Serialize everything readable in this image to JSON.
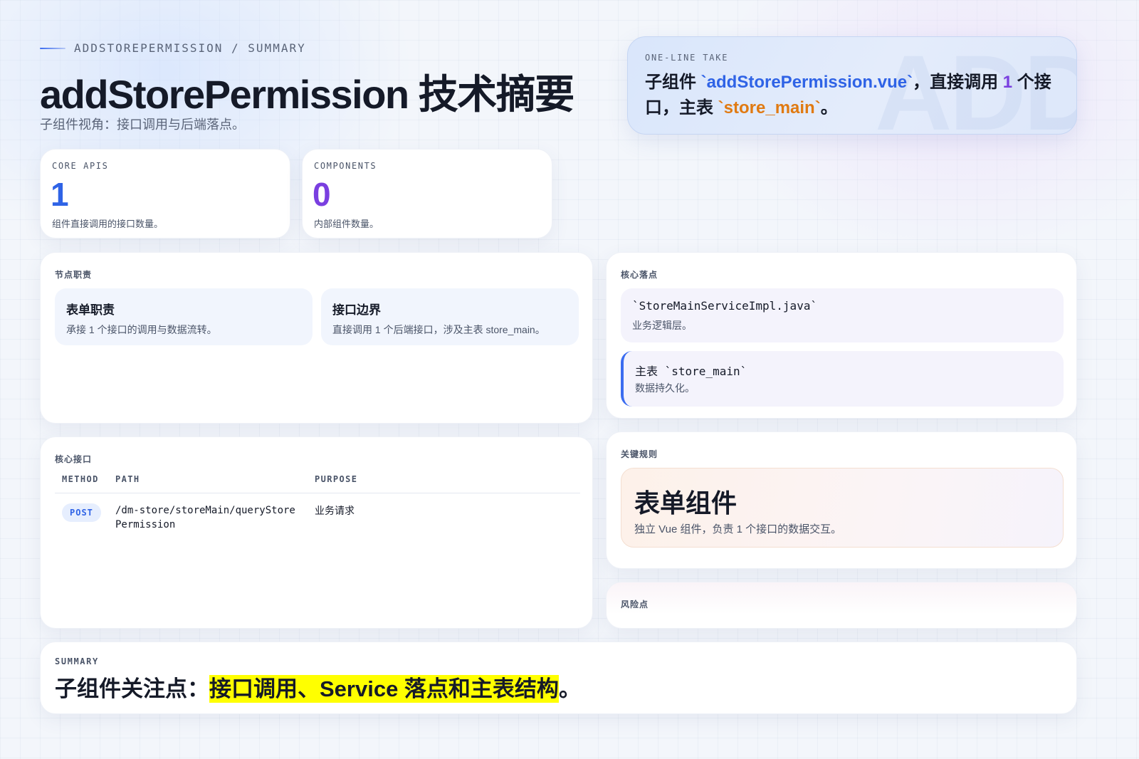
{
  "header": {
    "eyebrow": "ADDSTOREPERMISSION / SUMMARY",
    "title": "addStorePermission 技术摘要",
    "subtitle": "子组件视角：接口调用与后端落点。"
  },
  "take": {
    "label": "ONE-LINE TAKE",
    "watermark": "ADD",
    "parts": [
      "子组件 ",
      "`addStorePermission.vue`",
      "，直接调用 ",
      "1",
      " 个接口，主表 ",
      "`store_main`",
      "。"
    ]
  },
  "stats": [
    {
      "label": "CORE APIS",
      "value": "1",
      "desc": "组件直接调用的接口数量。",
      "color": "#2f63e6"
    },
    {
      "label": "COMPONENTS",
      "value": "0",
      "desc": "内部组件数量。",
      "color": "#7a3fe0"
    }
  ],
  "responsibilities": {
    "label": "节点职责",
    "items": [
      {
        "title": "表单职责",
        "desc": "承接 1 个接口的调用与数据流转。"
      },
      {
        "title": "接口边界",
        "desc": "直接调用 1 个后端接口，涉及主表 store_main。"
      }
    ]
  },
  "landing": {
    "label": "核心落点",
    "items": [
      {
        "title": "`StoreMainServiceImpl.java`",
        "desc": "业务逻辑层。"
      },
      {
        "title": "主表 `store_main`",
        "desc": "数据持久化。"
      }
    ]
  },
  "apis": {
    "label": "核心接口",
    "columns": [
      "METHOD",
      "PATH",
      "PURPOSE"
    ],
    "rows": [
      {
        "method": "POST",
        "path": "/dm-store/storeMain/queryStorePermission",
        "purpose": "业务请求"
      }
    ]
  },
  "rules": {
    "label": "关键规则",
    "title": "表单组件",
    "desc": "独立 Vue 组件，负责 1 个接口的数据交互。"
  },
  "risks": {
    "label": "风险点"
  },
  "summary": {
    "label": "SUMMARY",
    "prefix": "子组件关注点：",
    "highlight": "接口调用、Service 落点和主表结构",
    "suffix": "。"
  }
}
